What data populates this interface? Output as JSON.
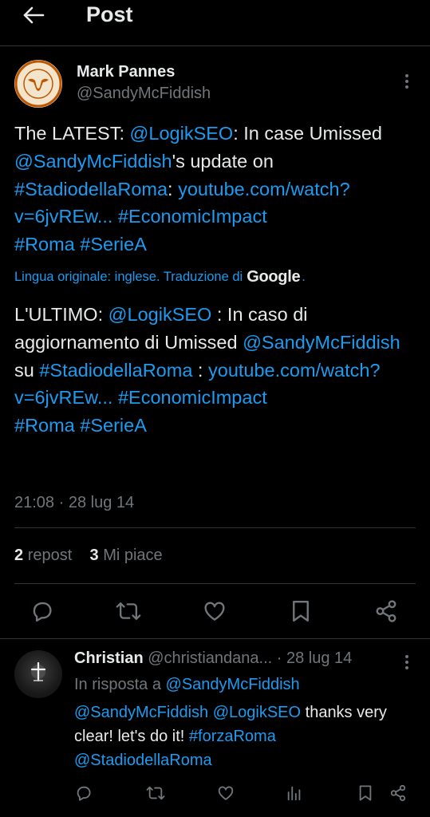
{
  "header": {
    "title": "Post"
  },
  "post": {
    "author_name": "Mark Pannes",
    "author_handle": "@SandyMcFiddish",
    "text_parts": [
      "The LATEST: ",
      "@LogikSEO",
      ": In case Umissed ",
      "@SandyMcFiddish",
      "'s update on ",
      "#StadiodellaRoma",
      ": ",
      "youtube.com/watch?v=6jvREw...",
      " ",
      "#EconomicImpact",
      " ",
      "#Roma",
      " ",
      "#SerieA"
    ],
    "translation_label": "Lingua originale: inglese. Traduzione di",
    "translation_brand": "Google",
    "translation_period": ".",
    "translated_parts": [
      "L'ULTIMO: ",
      "@LogikSEO",
      " : In caso di aggiornamento di Umissed ",
      "@SandyMcFiddish",
      " su ",
      "#StadiodellaRoma",
      " : ",
      "youtube.com/watch?v=6jvREw...",
      " ",
      "#EconomicImpact",
      " ",
      "#Roma",
      " ",
      "#SerieA"
    ],
    "timestamp": "21:08 · 28 lug 14",
    "reposts_count": "2",
    "reposts_label": "repost",
    "likes_count": "3",
    "likes_label": "Mi piace",
    "actions": [
      "reply-icon",
      "repost-icon",
      "like-icon",
      "bookmark-icon",
      "share-icon"
    ]
  },
  "reply": {
    "author_name": "Christian",
    "author_handle": "@christiandana...",
    "date": "· 28 lug 14",
    "reply_to_label": "In risposta a",
    "reply_to_handle": "@SandyMcFiddish",
    "text_parts": [
      "@SandyMcFiddish",
      " ",
      "@LogikSEO",
      " thanks very clear! let's do it! ",
      "#forzaRoma",
      " ",
      "@StadiodellaRoma"
    ],
    "actions": [
      "reply-icon",
      "repost-icon",
      "like-icon",
      "views-icon",
      "bookmark-icon",
      "share-icon"
    ]
  },
  "colors": {
    "background": "#000000",
    "text": "#e7e9ea",
    "link": "#1d9bf0",
    "muted": "#71767b",
    "divider": "#2f3336"
  }
}
